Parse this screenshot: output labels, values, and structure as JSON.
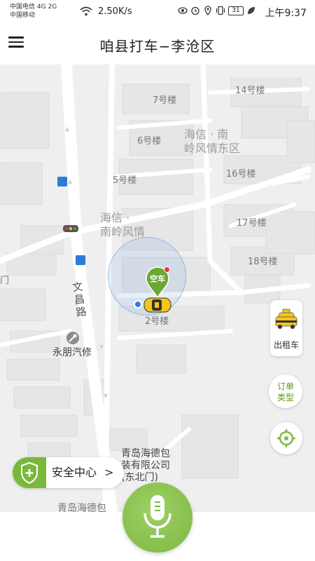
{
  "status_bar": {
    "carrier_1": "中国电信",
    "carrier_2": "中国移动",
    "net_1": "4G",
    "net_2": "2G",
    "speed": "2.50K/s",
    "battery": "31",
    "time": "上午9:37",
    "icons": [
      "wifi-icon",
      "eye-icon",
      "alarm-icon",
      "location-icon",
      "vibrate-icon",
      "battery-icon",
      "leaf-icon"
    ]
  },
  "header": {
    "title": "咱县打车−李沧区",
    "menu_icon": "hamburger-menu-icon"
  },
  "map": {
    "building_labels": [
      "7号楼",
      "14号楼",
      "6号楼",
      "5号楼",
      "16号楼",
      "17号楼",
      "18号楼",
      "2号楼"
    ],
    "area_label_1_line1": "海信 · 南",
    "area_label_1_line2": "岭风情东区",
    "area_label_2_line1": "海信 ·",
    "area_label_2_line2": "南岭风情",
    "road_name": "文昌路",
    "poi_repair": "永朋汽修",
    "poi_company_line1": "青岛海德包",
    "poi_company_line2": "装有限公司",
    "poi_company_line3": "(东北门)",
    "poi_bottom": "青岛海德包",
    "edge_glyph": "门",
    "pin_label": "空车"
  },
  "side": {
    "taxi_label": "出租车",
    "order_type_line1": "订单",
    "order_type_line2": "类型"
  },
  "safety": {
    "label": "安全中心",
    "chevron": ">"
  },
  "colors": {
    "brand_green": "#7cb842",
    "pin_green": "#6aa832",
    "taxi_yellow": "#f5c518",
    "range_blue": "#78aae6",
    "location_blue": "#2b7de9"
  }
}
